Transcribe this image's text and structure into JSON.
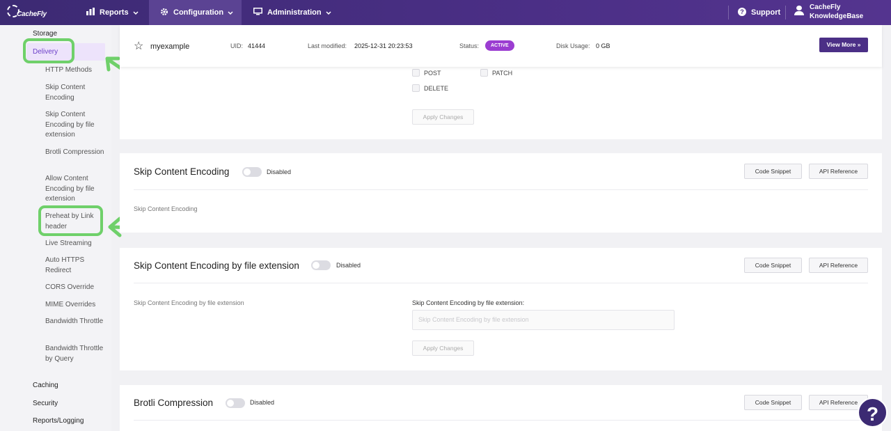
{
  "nav": {
    "logo": "CacheFly",
    "reports": "Reports",
    "configuration": "Configuration",
    "administration": "Administration",
    "support": "Support",
    "user_line1": "CacheFly",
    "user_line2": "KnowledgeBase"
  },
  "sidebar": {
    "storage": "Storage",
    "delivery": "Delivery",
    "sub_items": [
      "HTTP Methods",
      "Skip Content Encoding",
      "Skip Content Encoding by file extension",
      "Brotli Compression",
      "Allow Content Encoding by file extension",
      "Preheat by Link header",
      "Live Streaming",
      "Auto HTTPS Redirect",
      "CORS Override",
      "MIME Overrides",
      "Bandwidth Throttle",
      "Bandwidth Throttle by Query"
    ],
    "caching": "Caching",
    "security": "Security",
    "reports_logging": "Reports/Logging"
  },
  "summary": {
    "name": "myexample",
    "uid_label": "UID:",
    "uid": "41444",
    "modified_label": "Last modified:",
    "modified": "2025-12-31 20:23:53",
    "status_label": "Status:",
    "status": "ACTIVE",
    "disk_label": "Disk Usage:",
    "disk": "0 GB",
    "view_more": "View More »"
  },
  "http_methods": {
    "methods": [
      "POST",
      "PATCH",
      "DELETE"
    ],
    "apply": "Apply Changes"
  },
  "skip_content_encoding": {
    "title": "Skip Content Encoding",
    "state": "Disabled",
    "code_snippet": "Code Snippet",
    "api_reference": "API Reference",
    "description": "Skip Content Encoding"
  },
  "skip_by_ext": {
    "title": "Skip Content Encoding by file extension",
    "state": "Disabled",
    "code_snippet": "Code Snippet",
    "api_reference": "API Reference",
    "description": "Skip Content Encoding by file extension",
    "field_label": "Skip Content Encoding by file extension:",
    "placeholder": "Skip Content Encoding by file extension",
    "apply": "Apply Changes"
  },
  "brotli": {
    "title": "Brotli Compression",
    "state": "Disabled",
    "code_snippet": "Code Snippet",
    "api_reference": "API Reference"
  },
  "help_label": "?",
  "colors": {
    "nav_bg": "#4b2f86",
    "accent": "#6c3fc9",
    "status_badge": "#9b3dd1",
    "highlight_annotation": "#6fd06a"
  }
}
